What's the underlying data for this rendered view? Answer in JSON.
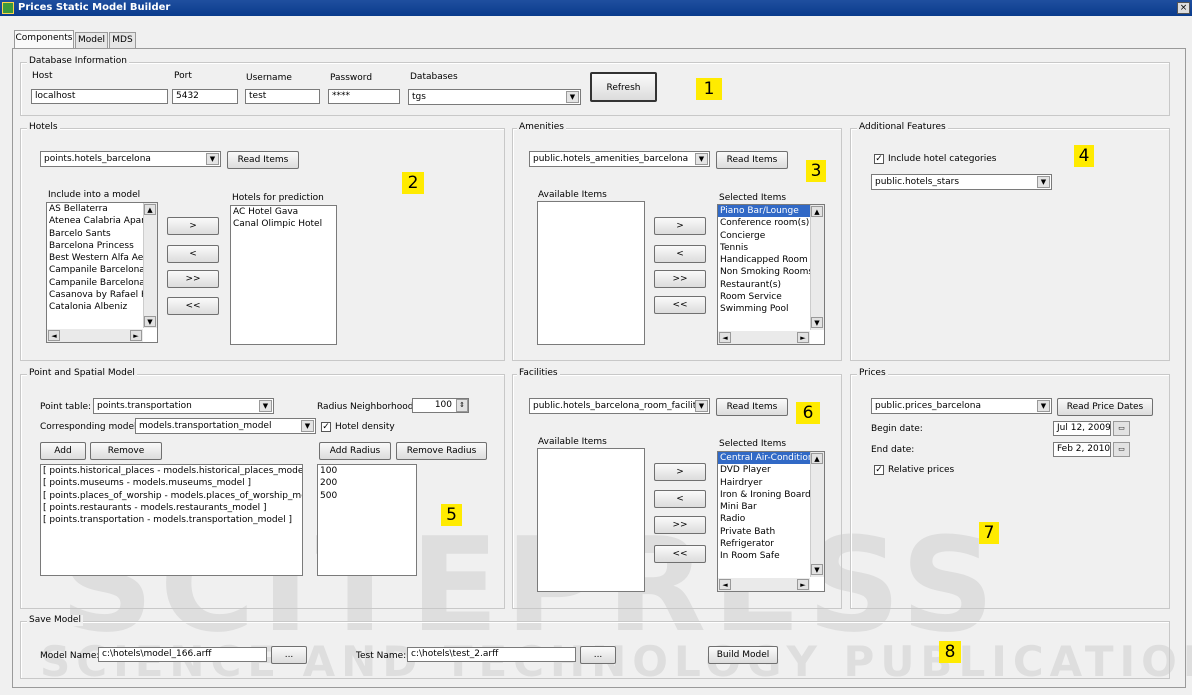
{
  "window": {
    "title": "Prices Static Model Builder",
    "close_glyph": "×"
  },
  "tabs": [
    "Components",
    "Model",
    "MDS"
  ],
  "db": {
    "group": "Database Information",
    "host_label": "Host",
    "host": "localhost",
    "port_label": "Port",
    "port": "5432",
    "user_label": "Username",
    "user": "test",
    "pass_label": "Password",
    "pass": "****",
    "db_label": "Databases",
    "db": "tgs",
    "refresh": "Refresh"
  },
  "hotels": {
    "group": "Hotels",
    "table": "points.hotels_barcelona",
    "read": "Read Items",
    "include_label": "Include into a model",
    "include_items": [
      "AS Bellaterra",
      "Atenea Calabria Aparta",
      "Barcelo Sants",
      "Barcelona Princess",
      "Best Western Alfa Aero",
      "Campanile Barcelona",
      "Campanile Barcelona Su",
      "Casanova by Rafael Ho",
      "Catalonia Albeniz"
    ],
    "predict_label": "Hotels for prediction",
    "predict_items": [
      "AC Hotel Gava",
      "Canal Olimpic Hotel"
    ],
    "move": [
      ">",
      "<",
      ">>",
      "<<"
    ]
  },
  "amenities": {
    "group": "Amenities",
    "table": "public.hotels_amenities_barcelona",
    "read": "Read Items",
    "available_label": "Available Items",
    "selected_label": "Selected Items",
    "selected_items": [
      "Piano Bar/Lounge",
      "Conference room(s)",
      "Concierge",
      "Tennis",
      "Handicapped Room",
      "Non Smoking Rooms",
      "Restaurant(s)",
      "Room Service",
      "Swimming Pool"
    ],
    "move": [
      ">",
      "<",
      ">>",
      "<<"
    ]
  },
  "additional": {
    "group": "Additional Features",
    "include_label": "Include hotel categories",
    "table": "public.hotels_stars"
  },
  "spatial": {
    "group": "Point and Spatial Model",
    "point_label": "Point table:",
    "point_table": "points.transportation",
    "radius_label": "Radius Neighborhood:",
    "radius": "100",
    "corr_label": "Corresponding model:",
    "corr_model": "models.transportation_model",
    "density_label": "Hotel density",
    "add": "Add",
    "remove": "Remove",
    "add_radius": "Add Radius",
    "remove_radius": "Remove Radius",
    "models": [
      "[ points.historical_places - models.historical_places_model ]",
      "[ points.museums - models.museums_model ]",
      "[ points.places_of_worship - models.places_of_worship_model ]",
      "[ points.restaurants - models.restaurants_model ]",
      "[ points.transportation - models.transportation_model ]"
    ],
    "radii": [
      "100",
      "200",
      "500"
    ]
  },
  "facilities": {
    "group": "Facilities",
    "table": "public.hotels_barcelona_room_facility",
    "read": "Read Items",
    "available_label": "Available Items",
    "selected_label": "Selected Items",
    "selected_items": [
      "Central Air-Conditioning",
      "DVD Player",
      "Hairdryer",
      "Iron & Ironing Board",
      "Mini Bar",
      "Radio",
      "Private Bath",
      "Refrigerator",
      "In Room Safe"
    ],
    "move": [
      ">",
      "<",
      ">>",
      "<<"
    ]
  },
  "prices": {
    "group": "Prices",
    "table": "public.prices_barcelona",
    "read": "Read Price Dates",
    "begin_label": "Begin date:",
    "begin": "Jul 12, 2009",
    "end_label": "End date:",
    "end": "Feb 2, 2010",
    "relative_label": "Relative prices"
  },
  "save": {
    "group": "Save Model",
    "model_label": "Model Name:",
    "model": "c:\\hotels\\model_166.arff",
    "browse": "...",
    "test_label": "Test Name:",
    "test": "c:\\hotels\\test_2.arff",
    "build": "Build Model"
  },
  "markers": [
    "1",
    "2",
    "3",
    "4",
    "5",
    "6",
    "7",
    "8"
  ],
  "watermark": {
    "top": "SCITEPRESS",
    "bottom": "SCIENCE AND TECHNOLOGY PUBLICATIONS"
  },
  "icons": {
    "check": "✓",
    "arrow_down": "▼",
    "arrow_up": "▲",
    "arrow_left": "◄",
    "arrow_right": "►",
    "spin": "⇕",
    "calendar": "▭"
  }
}
